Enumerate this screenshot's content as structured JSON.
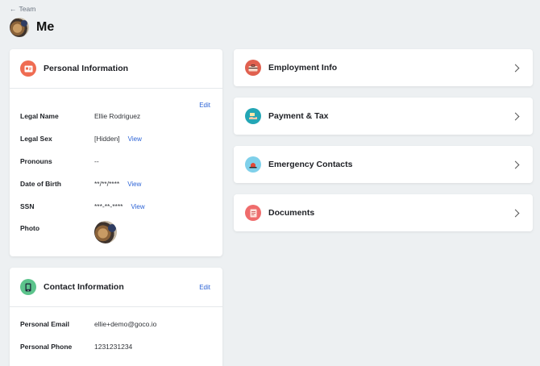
{
  "nav": {
    "back_label": "Team"
  },
  "header": {
    "title": "Me"
  },
  "personal": {
    "title": "Personal Information",
    "edit_label": "Edit",
    "fields": [
      {
        "label": "Legal Name",
        "value": "Ellie Rodriguez"
      },
      {
        "label": "Legal Sex",
        "value": "[Hidden]",
        "action": "View"
      },
      {
        "label": "Pronouns",
        "value": "--"
      },
      {
        "label": "Date of Birth",
        "value": "**/**/****",
        "action": "View"
      },
      {
        "label": "SSN",
        "value": "***-**-****",
        "action": "View"
      },
      {
        "label": "Photo",
        "value": ""
      }
    ],
    "icon": "id-card-icon",
    "icon_color": "#ef6c52"
  },
  "contact": {
    "title": "Contact Information",
    "edit_label": "Edit",
    "fields": [
      {
        "label": "Personal Email",
        "value": "ellie+demo@goco.io"
      },
      {
        "label": "Personal Phone",
        "value": "1231231234"
      }
    ],
    "icon": "phone-icon",
    "icon_color": "#5cc48c"
  },
  "sections": [
    {
      "label": "Employment Info",
      "icon": "briefcase-icon",
      "icon_color": "#e0604f"
    },
    {
      "label": "Payment & Tax",
      "icon": "money-hand-icon",
      "icon_color": "#23a6b5"
    },
    {
      "label": "Emergency Contacts",
      "icon": "siren-icon",
      "icon_color": "#7fd0ea"
    },
    {
      "label": "Documents",
      "icon": "document-icon",
      "icon_color": "#ef6c6c"
    }
  ]
}
